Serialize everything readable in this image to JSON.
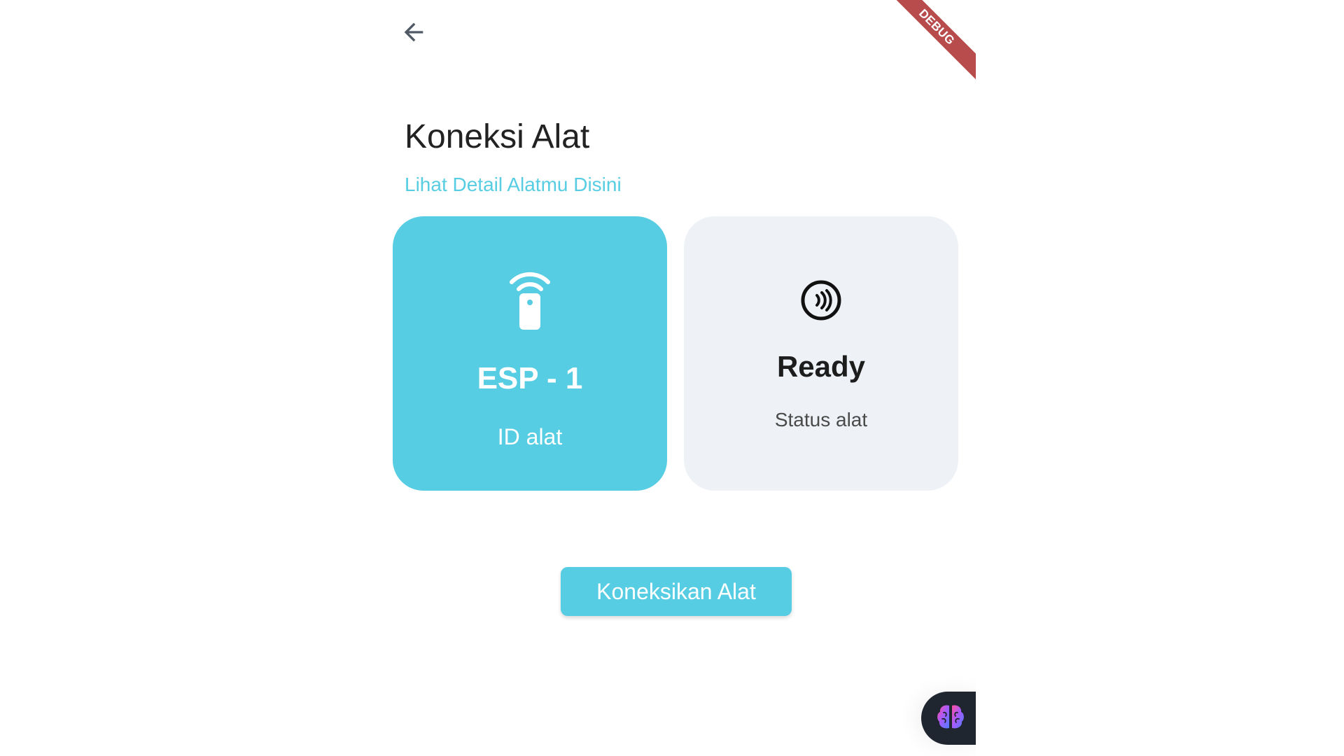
{
  "app": {
    "debug_banner": "DEBUG"
  },
  "header": {
    "back_icon": "arrow-left-icon"
  },
  "page": {
    "title": "Koneksi Alat",
    "subtitle": "Lihat Detail Alatmu Disini"
  },
  "cards": {
    "device": {
      "icon": "remote-wifi-icon",
      "value": "ESP - 1",
      "label": "ID alat"
    },
    "status": {
      "icon": "contactless-icon",
      "value": "Ready",
      "label": "Status alat"
    }
  },
  "actions": {
    "connect_label": "Koneksikan Alat"
  },
  "fab": {
    "icon": "brain-icon"
  },
  "colors": {
    "accent": "#57cde3",
    "card_muted": "#eef2f7",
    "debug": "#b84b4b",
    "fab_bg": "#1f2630"
  }
}
